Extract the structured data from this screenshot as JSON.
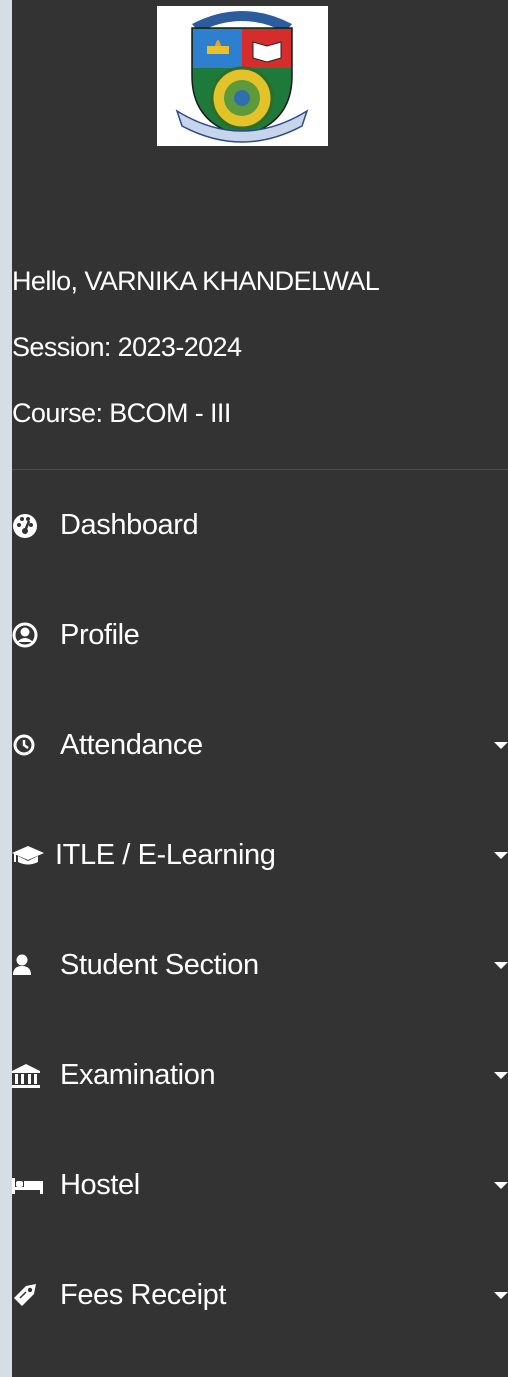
{
  "user": {
    "greeting": "Hello, VARNIKA KHANDELWAL",
    "session": "Session: 2023-2024",
    "course": "Course: BCOM - III"
  },
  "nav": {
    "items": [
      {
        "label": "Dashboard",
        "icon": "dashboard-gauge-icon",
        "has_submenu": false
      },
      {
        "label": "Profile",
        "icon": "user-circle-icon",
        "has_submenu": false
      },
      {
        "label": "Attendance",
        "icon": "clock-icon",
        "has_submenu": true
      },
      {
        "label": "ITLE / E-Learning",
        "icon": "graduation-cap-icon",
        "has_submenu": true
      },
      {
        "label": "Student Section",
        "icon": "user-icon",
        "has_submenu": true
      },
      {
        "label": "Examination",
        "icon": "institution-icon",
        "has_submenu": true
      },
      {
        "label": "Hostel",
        "icon": "bed-icon",
        "has_submenu": true
      },
      {
        "label": "Fees Receipt",
        "icon": "tag-icon",
        "has_submenu": true
      }
    ]
  },
  "colors": {
    "sidebar_bg": "#333333",
    "page_bg": "#d5dde5",
    "text": "#ffffff"
  }
}
